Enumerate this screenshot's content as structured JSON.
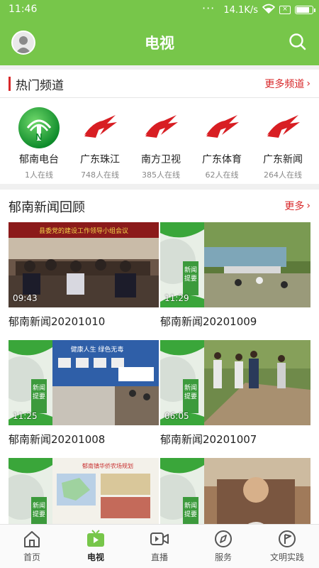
{
  "status_bar": {
    "time": "11:46",
    "dots": "···",
    "net_speed": "14.1K/s",
    "notice_icon": "x-box-icon",
    "battery_level": 0.85
  },
  "header": {
    "title": "电视",
    "avatar_icon": "user-avatar-icon",
    "search_icon": "search-icon"
  },
  "hot_channels": {
    "title": "热门频道",
    "more_label": "更多频道",
    "accent": "#d8282a",
    "items": [
      {
        "name": "郁南电台",
        "count": "1人在线",
        "logo": "yunan-radio-logo"
      },
      {
        "name": "广东珠江",
        "count": "748人在线",
        "logo": "guangdong-tv-logo"
      },
      {
        "name": "南方卫视",
        "count": "385人在线",
        "logo": "guangdong-tv-logo"
      },
      {
        "name": "广东体育",
        "count": "62人在线",
        "logo": "guangdong-tv-logo"
      },
      {
        "name": "广东新闻",
        "count": "264人在线",
        "logo": "guangdong-tv-logo"
      }
    ]
  },
  "news_review": {
    "title": "郁南新闻回顾",
    "more_label": "更多",
    "items": [
      {
        "title": "郁南新闻20201010",
        "duration": "09:43",
        "scene": "meeting"
      },
      {
        "title": "郁南新闻20201009",
        "duration": "11:29",
        "scene": "park"
      },
      {
        "title": "郁南新闻20201008",
        "duration": "11:25",
        "scene": "exhibit"
      },
      {
        "title": "郁南新闻20201007",
        "duration": "06:05",
        "scene": "road"
      },
      {
        "title": "",
        "duration": "",
        "scene": "poster"
      },
      {
        "title": "",
        "duration": "",
        "scene": "portrait"
      }
    ],
    "badge_text": "新闻提要"
  },
  "tabbar": {
    "active_color": "#77c64a",
    "tabs": [
      {
        "label": "首页",
        "icon": "home-icon"
      },
      {
        "label": "电视",
        "icon": "tv-icon"
      },
      {
        "label": "直播",
        "icon": "live-camera-icon"
      },
      {
        "label": "服务",
        "icon": "compass-icon"
      },
      {
        "label": "文明实践",
        "icon": "flag-badge-icon"
      }
    ]
  }
}
